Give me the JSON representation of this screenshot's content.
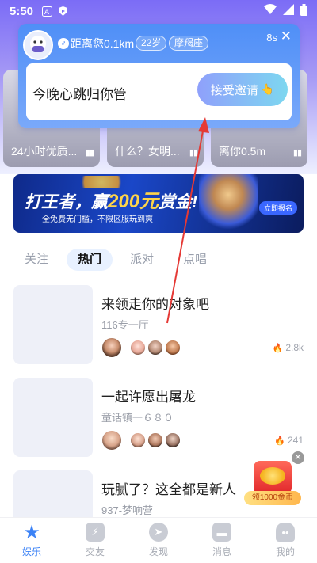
{
  "status_bar": {
    "time": "5:50",
    "icons": [
      "font-a-icon",
      "shield-play-icon",
      "wifi-icon",
      "signal-icon",
      "battery-icon"
    ]
  },
  "cards": [
    {
      "label": "24小时优质..."
    },
    {
      "label": "什么？女明..."
    },
    {
      "label": "离你0.5m"
    }
  ],
  "popup": {
    "distance": "距离您0.1km",
    "age": "22岁",
    "zodiac": "摩羯座",
    "timer": "8s",
    "message": "今晚心跳归你管",
    "accept_label": "接受邀请"
  },
  "banner": {
    "title_pre": "打王者，赢",
    "title_highlight": "200元",
    "title_post": "赏金!",
    "subtitle": "全免费无门槛，不限区服玩到爽",
    "register_label": "立即报名"
  },
  "tabs": [
    {
      "label": "关注",
      "active": false
    },
    {
      "label": "热门",
      "active": true
    },
    {
      "label": "派对",
      "active": false
    },
    {
      "label": "点唱",
      "active": false
    }
  ],
  "rooms": [
    {
      "title": "来领走你的对象吧",
      "subtitle": "116专一厅",
      "heat": "2.8k"
    },
    {
      "title": "一起许愿出屠龙",
      "subtitle": "童话镇一６８０",
      "heat": "241"
    },
    {
      "title": "玩腻了？这全都是新人",
      "subtitle": "937-梦响营",
      "heat": ""
    }
  ],
  "coin_widget": {
    "label": "领1000金币"
  },
  "nav": [
    {
      "label": "娱乐",
      "icon": "star-icon",
      "active": true
    },
    {
      "label": "交友",
      "icon": "lightning-icon",
      "active": false
    },
    {
      "label": "发现",
      "icon": "compass-icon",
      "active": false
    },
    {
      "label": "消息",
      "icon": "message-icon",
      "active": false
    },
    {
      "label": "我的",
      "icon": "profile-icon",
      "active": false
    }
  ],
  "colors": {
    "accent": "#3b82f6",
    "popup_blue": "#4f8ff7",
    "annotation_arrow": "#e53935"
  }
}
